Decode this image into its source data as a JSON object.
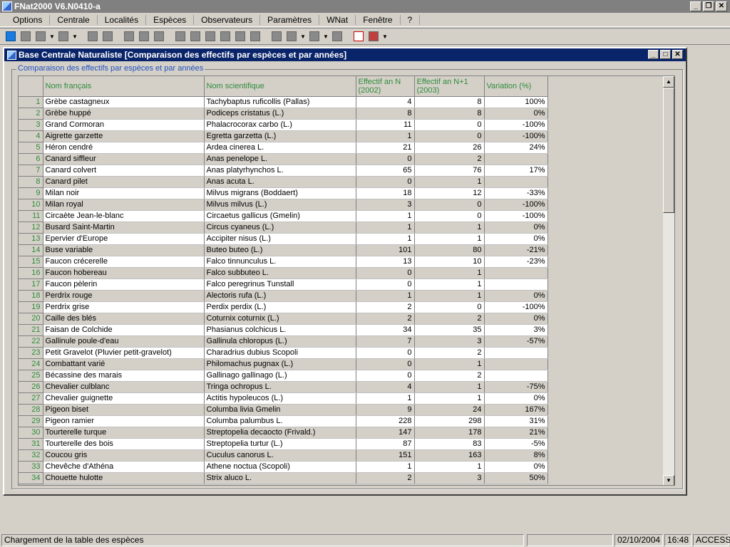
{
  "app": {
    "title": "FNat2000 V6.N0410-a"
  },
  "menu": [
    "Options",
    "Centrale",
    "Localités",
    "Espèces",
    "Observateurs",
    "Paramètres",
    "WNat",
    "Fenêtre",
    "?"
  ],
  "window": {
    "title": "Base Centrale Naturaliste [Comparaison des effectifs par espèces et par années]"
  },
  "group": {
    "caption": "Comparaison des effectifs par espèces et par années"
  },
  "table": {
    "headers": {
      "nom_francais": "Nom français",
      "nom_scientifique": "Nom scientifique",
      "effectif_n": "Effectif an N (2002)",
      "effectif_n1": "Effectif an N+1 (2003)",
      "variation": "Variation (%)"
    },
    "rows": [
      [
        "1",
        "Grèbe castagneux",
        "Tachybaptus ruficollis (Pallas)",
        "4",
        "8",
        "100%"
      ],
      [
        "2",
        "Grèbe huppé",
        "Podiceps cristatus (L.)",
        "8",
        "8",
        "0%"
      ],
      [
        "3",
        "Grand Cormoran",
        "Phalacrocorax carbo (L.)",
        "11",
        "0",
        "-100%"
      ],
      [
        "4",
        "Aigrette garzette",
        "Egretta garzetta (L.)",
        "1",
        "0",
        "-100%"
      ],
      [
        "5",
        "Héron cendré",
        "Ardea cinerea L.",
        "21",
        "26",
        "24%"
      ],
      [
        "6",
        "Canard siffleur",
        "Anas penelope L.",
        "0",
        "2",
        ""
      ],
      [
        "7",
        "Canard colvert",
        "Anas platyrhynchos L.",
        "65",
        "76",
        "17%"
      ],
      [
        "8",
        "Canard pilet",
        "Anas acuta L.",
        "0",
        "1",
        ""
      ],
      [
        "9",
        "Milan noir",
        "Milvus migrans (Boddaert)",
        "18",
        "12",
        "-33%"
      ],
      [
        "10",
        "Milan royal",
        "Milvus milvus (L.)",
        "3",
        "0",
        "-100%"
      ],
      [
        "11",
        "Circaète Jean-le-blanc",
        "Circaetus gallicus (Gmelin)",
        "1",
        "0",
        "-100%"
      ],
      [
        "12",
        "Busard Saint-Martin",
        "Circus cyaneus (L.)",
        "1",
        "1",
        "0%"
      ],
      [
        "13",
        "Epervier d'Europe",
        "Accipiter nisus (L.)",
        "1",
        "1",
        "0%"
      ],
      [
        "14",
        "Buse variable",
        "Buteo buteo (L.)",
        "101",
        "80",
        "-21%"
      ],
      [
        "15",
        "Faucon crécerelle",
        "Falco tinnunculus L.",
        "13",
        "10",
        "-23%"
      ],
      [
        "16",
        "Faucon hobereau",
        "Falco subbuteo L.",
        "0",
        "1",
        ""
      ],
      [
        "17",
        "Faucon pèlerin",
        "Falco peregrinus Tunstall",
        "0",
        "1",
        ""
      ],
      [
        "18",
        "Perdrix rouge",
        "Alectoris rufa (L.)",
        "1",
        "1",
        "0%"
      ],
      [
        "19",
        "Perdrix grise",
        "Perdix perdix (L.)",
        "2",
        "0",
        "-100%"
      ],
      [
        "20",
        "Caille des blés",
        "Coturnix coturnix (L.)",
        "2",
        "2",
        "0%"
      ],
      [
        "21",
        "Faisan de Colchide",
        "Phasianus colchicus L.",
        "34",
        "35",
        "3%"
      ],
      [
        "22",
        "Gallinule poule-d'eau",
        "Gallinula chloropus (L.)",
        "7",
        "3",
        "-57%"
      ],
      [
        "23",
        "Petit Gravelot (Pluvier petit-gravelot)",
        "Charadrius dubius Scopoli",
        "0",
        "2",
        ""
      ],
      [
        "24",
        "Combattant varié",
        "Philomachus pugnax (L.)",
        "0",
        "1",
        ""
      ],
      [
        "25",
        "Bécassine des marais",
        "Gallinago gallinago (L.)",
        "0",
        "2",
        ""
      ],
      [
        "26",
        "Chevalier culblanc",
        "Tringa ochropus L.",
        "4",
        "1",
        "-75%"
      ],
      [
        "27",
        "Chevalier guignette",
        "Actitis hypoleucos (L.)",
        "1",
        "1",
        "0%"
      ],
      [
        "28",
        "Pigeon biset",
        "Columba livia Gmelin",
        "9",
        "24",
        "167%"
      ],
      [
        "29",
        "Pigeon ramier",
        "Columba palumbus L.",
        "228",
        "298",
        "31%"
      ],
      [
        "30",
        "Tourterelle turque",
        "Streptopelia decaocto (Frivald.)",
        "147",
        "178",
        "21%"
      ],
      [
        "31",
        "Tourterelle des bois",
        "Streptopelia turtur (L.)",
        "87",
        "83",
        "-5%"
      ],
      [
        "32",
        "Coucou gris",
        "Cuculus canorus L.",
        "151",
        "163",
        "8%"
      ],
      [
        "33",
        "Chevêche d'Athéna",
        "Athene noctua (Scopoli)",
        "1",
        "1",
        "0%"
      ],
      [
        "34",
        "Chouette hulotte",
        "Strix aluco L.",
        "2",
        "3",
        "50%"
      ]
    ]
  },
  "status": {
    "message": "Chargement de la table des espèces",
    "date": "02/10/2004",
    "time": "16:48",
    "mode": "ACCESS"
  },
  "colors": {
    "header_text": "#2e8b3a",
    "active_title": "#0a246a"
  }
}
